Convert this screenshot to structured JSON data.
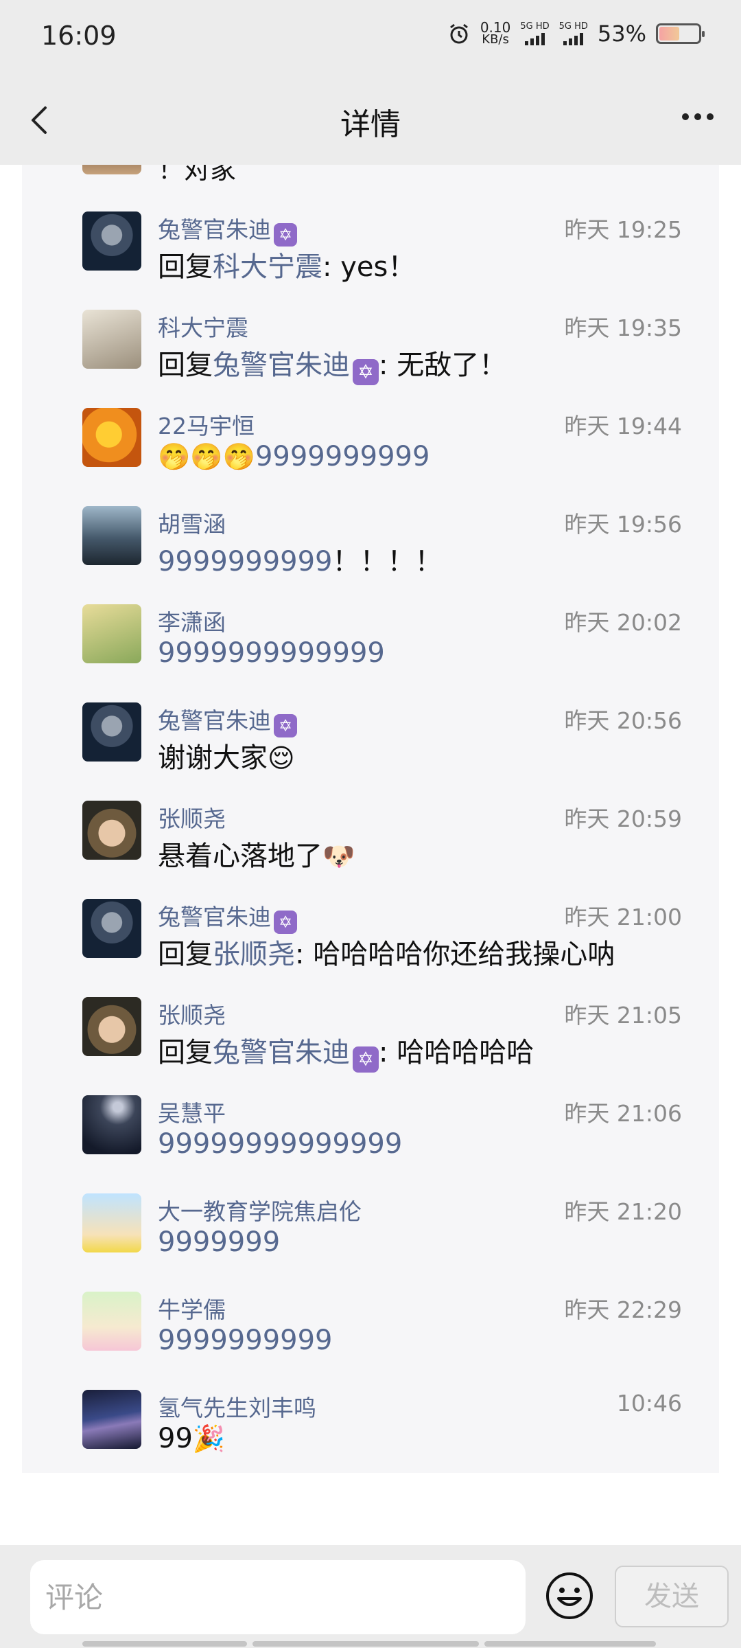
{
  "status_bar": {
    "time": "16:09",
    "net_speed_value": "0.10",
    "net_speed_unit": "KB/s",
    "sim1_label": "5G HD",
    "sim2_label": "5G HD",
    "battery_percent": "53%",
    "battery_level": 0.53
  },
  "nav": {
    "title": "详情"
  },
  "partial_comment": {
    "text": "！对家"
  },
  "comments": [
    {
      "author": "兔警官朱迪",
      "badge": "✡",
      "time": "昨天 19:25",
      "reply_prefix": "回复",
      "reply_to": "科大宁震",
      "reply_badge": "",
      "text": ": yes！"
    },
    {
      "author": "科大宁震",
      "badge": "",
      "time": "昨天 19:35",
      "reply_prefix": "回复",
      "reply_to": "兔警官朱迪",
      "reply_badge": "✡",
      "text": ": 无敌了！"
    },
    {
      "author": "22马宇恒",
      "badge": "",
      "time": "昨天 19:44",
      "emoji": "🤭🤭🤭",
      "text": "9999999999"
    },
    {
      "author": "胡雪涵",
      "badge": "",
      "time": "昨天 19:56",
      "text": "9999999999",
      "text_suffix": "！！！！"
    },
    {
      "author": "李潇函",
      "badge": "",
      "time": "昨天 20:02",
      "text": "9999999999999"
    },
    {
      "author": "兔警官朱迪",
      "badge": "✡",
      "time": "昨天 20:56",
      "text": "谢谢大家",
      "emoji": "😌"
    },
    {
      "author": "张顺尧",
      "badge": "",
      "time": "昨天 20:59",
      "text": "悬着心落地了",
      "emoji": "🐶"
    },
    {
      "author": "兔警官朱迪",
      "badge": "✡",
      "time": "昨天 21:00",
      "reply_prefix": "回复",
      "reply_to": "张顺尧",
      "reply_badge": "",
      "text": ": 哈哈哈哈你还给我操心呐"
    },
    {
      "author": "张顺尧",
      "badge": "",
      "time": "昨天 21:05",
      "reply_prefix": "回复",
      "reply_to": "兔警官朱迪",
      "reply_badge": "✡",
      "text": ": 哈哈哈哈哈"
    },
    {
      "author": "吴慧平",
      "badge": "",
      "time": "昨天 21:06",
      "text": "99999999999999"
    },
    {
      "author": "大一教育学院焦启伦",
      "badge": "",
      "time": "昨天 21:20",
      "text": "9999999"
    },
    {
      "author": "牛学儒",
      "badge": "",
      "time": "昨天 22:29",
      "text": "9999999999"
    },
    {
      "author": "氢气先生刘丰鸣",
      "badge": "",
      "time": "10:46",
      "text": "99",
      "emoji": "🎉"
    }
  ],
  "composer": {
    "placeholder": "评论",
    "send_label": "发送"
  },
  "icons": {
    "back": "chevron-left-icon",
    "more": "more-dots-icon",
    "emoji": "smiley-icon",
    "alarm": "alarm-icon",
    "badge": "star-of-david-badge"
  }
}
